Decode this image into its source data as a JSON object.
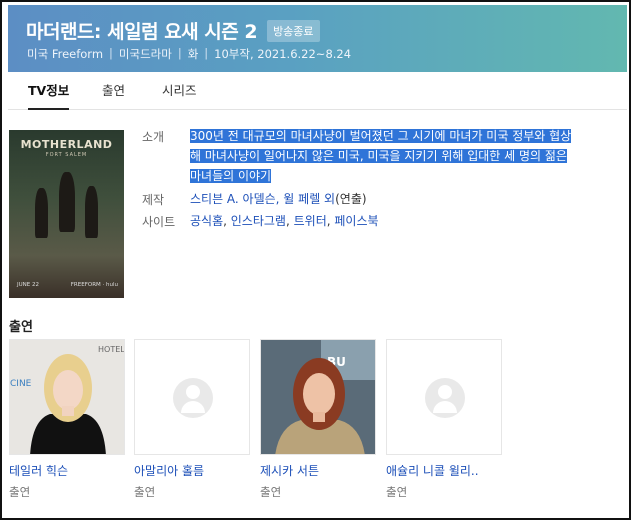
{
  "header": {
    "title": "마더랜드: 세일럼 요새 시즌 2",
    "badge": "방송종료",
    "meta": [
      "미국 Freeform",
      "미국드라마",
      "화",
      "10부작, 2021.6.22~8.24"
    ]
  },
  "tabs": [
    "TV정보",
    "출연",
    "시리즈"
  ],
  "poster": {
    "title": "MOTHERLAND",
    "subtitle": "FORT SALEM",
    "date": "JUNE 22",
    "network": "FREEFORM · hulu"
  },
  "info": {
    "intro_label": "소개",
    "intro_lines": [
      "300년 전 대규모의 마녀사냥이 벌어졌던 그 시기에 마녀가 미국 정부와 협상",
      "해 마녀사냥이 일어나지 않은 미국, 미국을 지키기 위해 입대한 세 명의 젊은",
      "마녀들의 이야기"
    ],
    "director_label": "제작",
    "director_links": "스티븐 A. 아델슨, 윌 페렐 외",
    "director_suffix": "(연출)",
    "site_label": "사이트",
    "sites": [
      "공식홈",
      "인스타그램",
      "트위터",
      "페이스북"
    ],
    "site_sep": ", "
  },
  "cast": {
    "title": "출연",
    "members": [
      {
        "name": "테일러 힉슨",
        "role": "출연"
      },
      {
        "name": "아말리아 홀름",
        "role": "출연"
      },
      {
        "name": "제시카 서튼",
        "role": "출연"
      },
      {
        "name": "애슐리 니콜 윌리..",
        "role": "출연"
      }
    ]
  }
}
